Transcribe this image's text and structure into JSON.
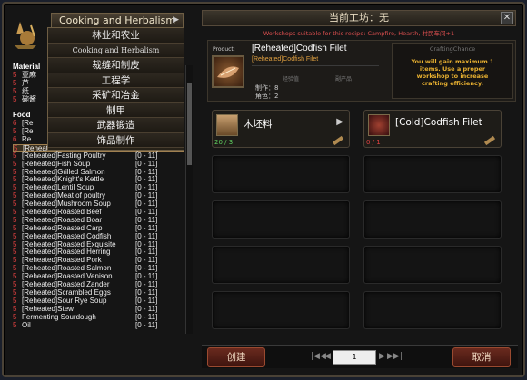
{
  "header": {
    "category_title": "Cooking and Herbalism",
    "workshop_title": "当前工坊：无",
    "workshop_note": "Workshops suitable for this recipe: Campfire, Hearth, 村民车间+1"
  },
  "dropdown": [
    {
      "label": "林业和农业"
    },
    {
      "label": "Cooking and Herbalism",
      "small": true
    },
    {
      "label": "裁缝和制皮"
    },
    {
      "label": "工程学"
    },
    {
      "label": "采矿和冶金"
    },
    {
      "label": "制甲"
    },
    {
      "label": "武器锻造"
    },
    {
      "label": "饰品制作"
    }
  ],
  "list": {
    "material_header": "Material",
    "materials": [
      {
        "num": "5",
        "name": "亚麻"
      },
      {
        "num": "5",
        "name": "芦"
      },
      {
        "num": "5",
        "name": "纸"
      },
      {
        "num": "5",
        "name": "碗酱"
      }
    ],
    "food_header": "Food",
    "foods_top": [
      {
        "num": "6",
        "name": "[Re"
      },
      {
        "num": "5",
        "name": "[Re"
      },
      {
        "num": "6",
        "name": "Re"
      }
    ],
    "recipes": [
      {
        "num": "5",
        "name": "[Reheated]Codfish Filet",
        "lvl": "[0 - 11]",
        "selected": true
      },
      {
        "num": "5",
        "name": "[Reheated]Fasting Poultry",
        "lvl": "[0 - 11]"
      },
      {
        "num": "5",
        "name": "[Reheated]Fish Soup",
        "lvl": "[0 - 11]"
      },
      {
        "num": "5",
        "name": "[Reheated]Grilled Salmon",
        "lvl": "[0 - 11]"
      },
      {
        "num": "5",
        "name": "[Reheated]Knight's Kettle",
        "lvl": "[0 - 11]"
      },
      {
        "num": "5",
        "name": "[Reheated]Lentil Soup",
        "lvl": "[0 - 11]"
      },
      {
        "num": "5",
        "name": "[Reheated]Meat of poultry",
        "lvl": "[0 - 11]"
      },
      {
        "num": "5",
        "name": "[Reheated]Mushroom Soup",
        "lvl": "[0 - 11]"
      },
      {
        "num": "5",
        "name": "[Reheated]Roasted Beef",
        "lvl": "[0 - 11]"
      },
      {
        "num": "5",
        "name": "[Reheated]Roasted Boar",
        "lvl": "[0 - 11]"
      },
      {
        "num": "5",
        "name": "[Reheated]Roasted Carp",
        "lvl": "[0 - 11]"
      },
      {
        "num": "5",
        "name": "[Reheated]Roasted Codfish",
        "lvl": "[0 - 11]"
      },
      {
        "num": "5",
        "name": "[Reheated]Roasted Exquisite",
        "lvl": "[0 - 11]"
      },
      {
        "num": "5",
        "name": "[Reheated]Roasted Herring",
        "lvl": "[0 - 11]"
      },
      {
        "num": "5",
        "name": "[Reheated]Roasted Pork",
        "lvl": "[0 - 11]"
      },
      {
        "num": "5",
        "name": "[Reheated]Roasted Salmon",
        "lvl": "[0 - 11]"
      },
      {
        "num": "5",
        "name": "[Reheated]Roasted Venison",
        "lvl": "[0 - 11]"
      },
      {
        "num": "5",
        "name": "[Reheated]Roasted Zander",
        "lvl": "[0 - 11]"
      },
      {
        "num": "5",
        "name": "[Reheated]Scrambled Eggs",
        "lvl": "[0 - 11]"
      },
      {
        "num": "5",
        "name": "[Reheated]Sour Rye Soup",
        "lvl": "[0 - 11]"
      },
      {
        "num": "5",
        "name": "[Reheated]Stew",
        "lvl": "[0 - 11]"
      },
      {
        "num": "5",
        "name": "Fermenting Sourdough",
        "lvl": "[0 - 11]"
      },
      {
        "num": "5",
        "name": "Oil",
        "lvl": "[0 - 11]"
      }
    ]
  },
  "product": {
    "label": "Product:",
    "name": "[Reheated]Codfish Filet",
    "sub": "[Reheated]Codfish Filet",
    "stat_label_1": "经验值",
    "stat_label_2": "副产品",
    "stat_1": "制作：8",
    "stat_2": "角色：2",
    "craft_header": "CraftingChance",
    "craft_text": "You will gain maximum 1 items. Use a proper workshop to increase crafting efficiency."
  },
  "ingredients": [
    {
      "name": "木坯料",
      "count": "20 / 3",
      "count_color": "#60d060"
    },
    {
      "name": "[Cold]Codfish Filet",
      "count": "0 / 1",
      "count_color": "#e04040"
    }
  ],
  "buttons": {
    "create": "创建",
    "cancel": "取消"
  },
  "pager": {
    "first": "|◀◀",
    "prev": "◀",
    "page": "1",
    "next": "▶",
    "last": "▶▶|"
  },
  "colors": {
    "accent": "#e8b030",
    "danger": "#e04040",
    "ok": "#60d060"
  }
}
